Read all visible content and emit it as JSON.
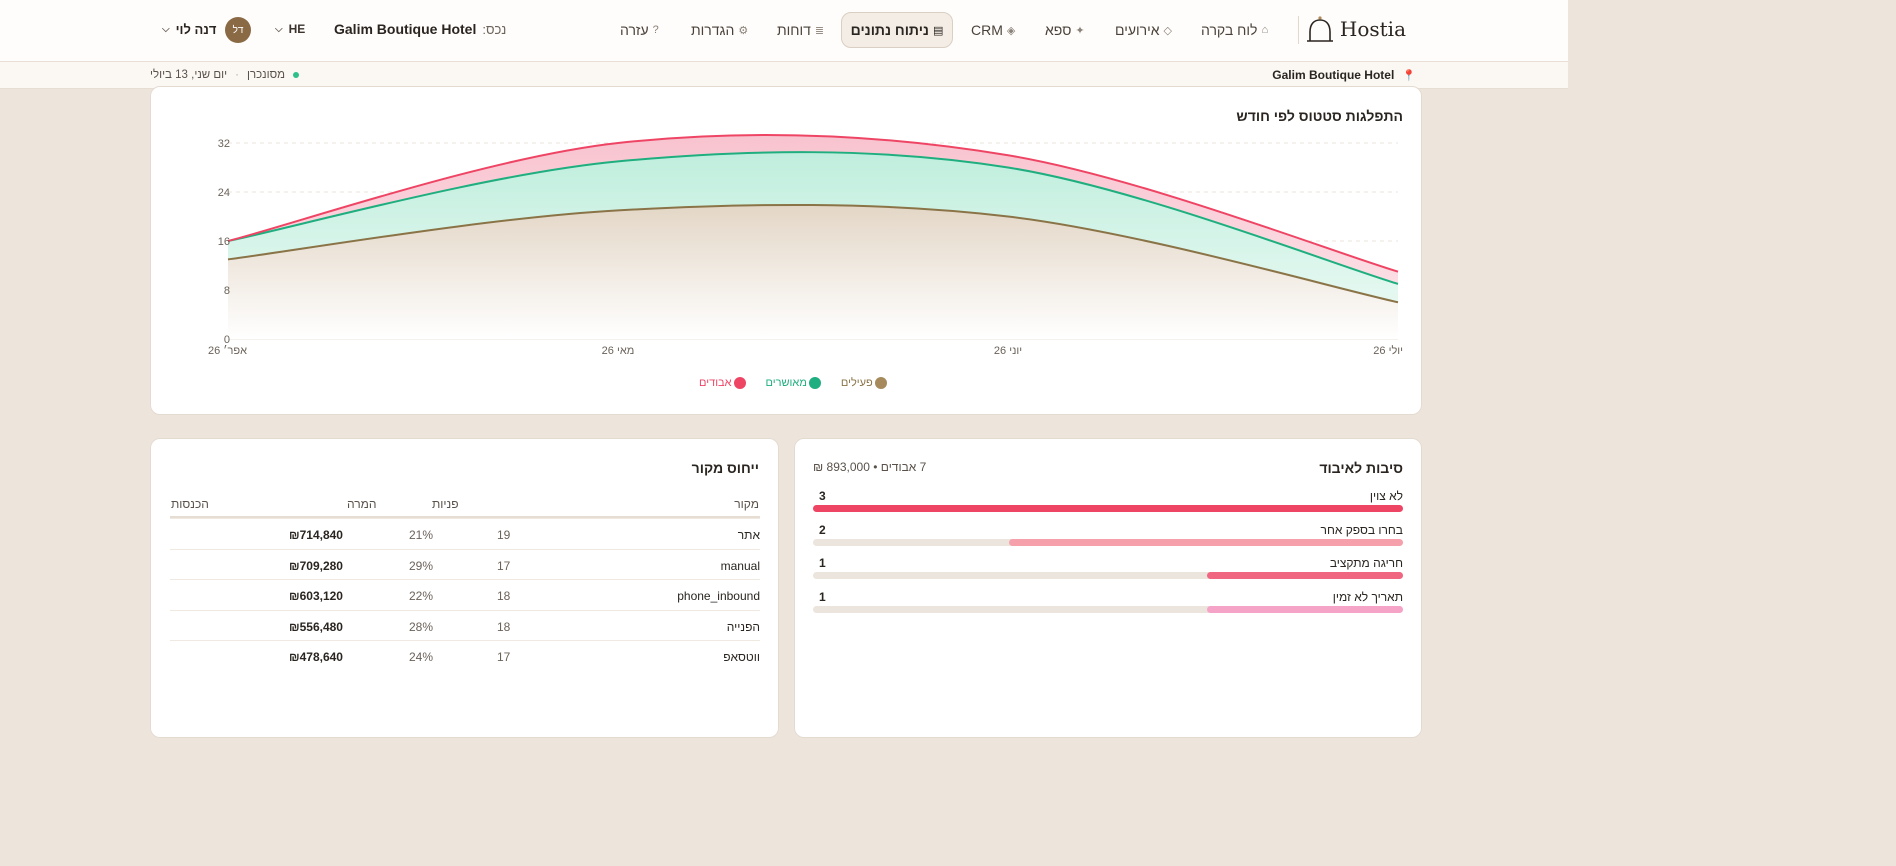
{
  "brand": {
    "name": "Hostia"
  },
  "nav": {
    "items": [
      {
        "label": "לוח בקרה",
        "icon": "⌂"
      },
      {
        "label": "אירועים",
        "icon": "◇"
      },
      {
        "label": "ספא",
        "icon": "✦"
      },
      {
        "label": "CRM",
        "icon": "◈"
      },
      {
        "label": "ניתוח נתונים",
        "icon": "▤"
      },
      {
        "label": "דוחות",
        "icon": "≣"
      },
      {
        "label": "הגדרות",
        "icon": "⚙"
      },
      {
        "label": "עזרה",
        "icon": "?"
      }
    ],
    "active": "ניתוח נתונים"
  },
  "property": {
    "label": "נכס:",
    "name": "Galim Boutique Hotel"
  },
  "language": "HE",
  "user": {
    "initials": "דל",
    "name": "דנה לוי"
  },
  "subbar": {
    "property": "Galim Boutique Hotel",
    "date": "יום שני, 13 ביולי",
    "status": "מסונכרן"
  },
  "colors": {
    "active": "#8a7447",
    "confirmed": "#1fae7f",
    "lost": "#ef4565",
    "accent_bg": "#ede5dc"
  },
  "status_chart": {
    "title": "התפלגות סטטוס לפי חודש",
    "legend": [
      "פעילים",
      "מאושרים",
      "אבודים"
    ]
  },
  "chart_data": {
    "type": "area",
    "title": "התפלגות סטטוס לפי חודש",
    "x": [
      "אפר׳ 26",
      "מאי 26",
      "יוני 26",
      "יולי 26"
    ],
    "ylim": [
      0,
      32
    ],
    "yticks": [
      0,
      8,
      16,
      24,
      32
    ],
    "stacked": true,
    "grid": true,
    "legend_position": "bottom",
    "series": [
      {
        "name": "פעילים",
        "values": [
          13,
          21,
          20,
          6
        ]
      },
      {
        "name": "מאושרים",
        "values": [
          3,
          8,
          8,
          3
        ]
      },
      {
        "name": "אבודים",
        "values": [
          0,
          3,
          2,
          2
        ]
      }
    ]
  },
  "loss_reasons": {
    "title": "סיבות לאיבוד",
    "summary": "7 אבודים • 893,000 ₪",
    "items": [
      {
        "label": "לא צוין",
        "count": "3",
        "fraction": 1.0,
        "color": "#ef4565"
      },
      {
        "label": "בחרו בספק אחר",
        "count": "2",
        "fraction": 0.667,
        "color": "#f5a0ab"
      },
      {
        "label": "חריגה מתקציב",
        "count": "1",
        "fraction": 0.333,
        "color": "#f06580"
      },
      {
        "label": "תאריך לא זמין",
        "count": "1",
        "fraction": 0.333,
        "color": "#f5a3c7"
      }
    ]
  },
  "source_attribution": {
    "title": "ייחוס מקור",
    "headers": {
      "source": "מקור",
      "inquiries": "פניות",
      "conversion": "המרה",
      "revenue": "הכנסות"
    },
    "rows": [
      {
        "source": "אתר",
        "inquiries": "19",
        "conversion": "21%",
        "revenue": "₪714,840"
      },
      {
        "source": "manual",
        "inquiries": "17",
        "conversion": "29%",
        "revenue": "₪709,280"
      },
      {
        "source": "phone_inbound",
        "inquiries": "18",
        "conversion": "22%",
        "revenue": "₪603,120"
      },
      {
        "source": "הפנייה",
        "inquiries": "18",
        "conversion": "28%",
        "revenue": "₪556,480"
      },
      {
        "source": "ווטסאפ",
        "inquiries": "17",
        "conversion": "24%",
        "revenue": "₪478,640"
      }
    ]
  }
}
